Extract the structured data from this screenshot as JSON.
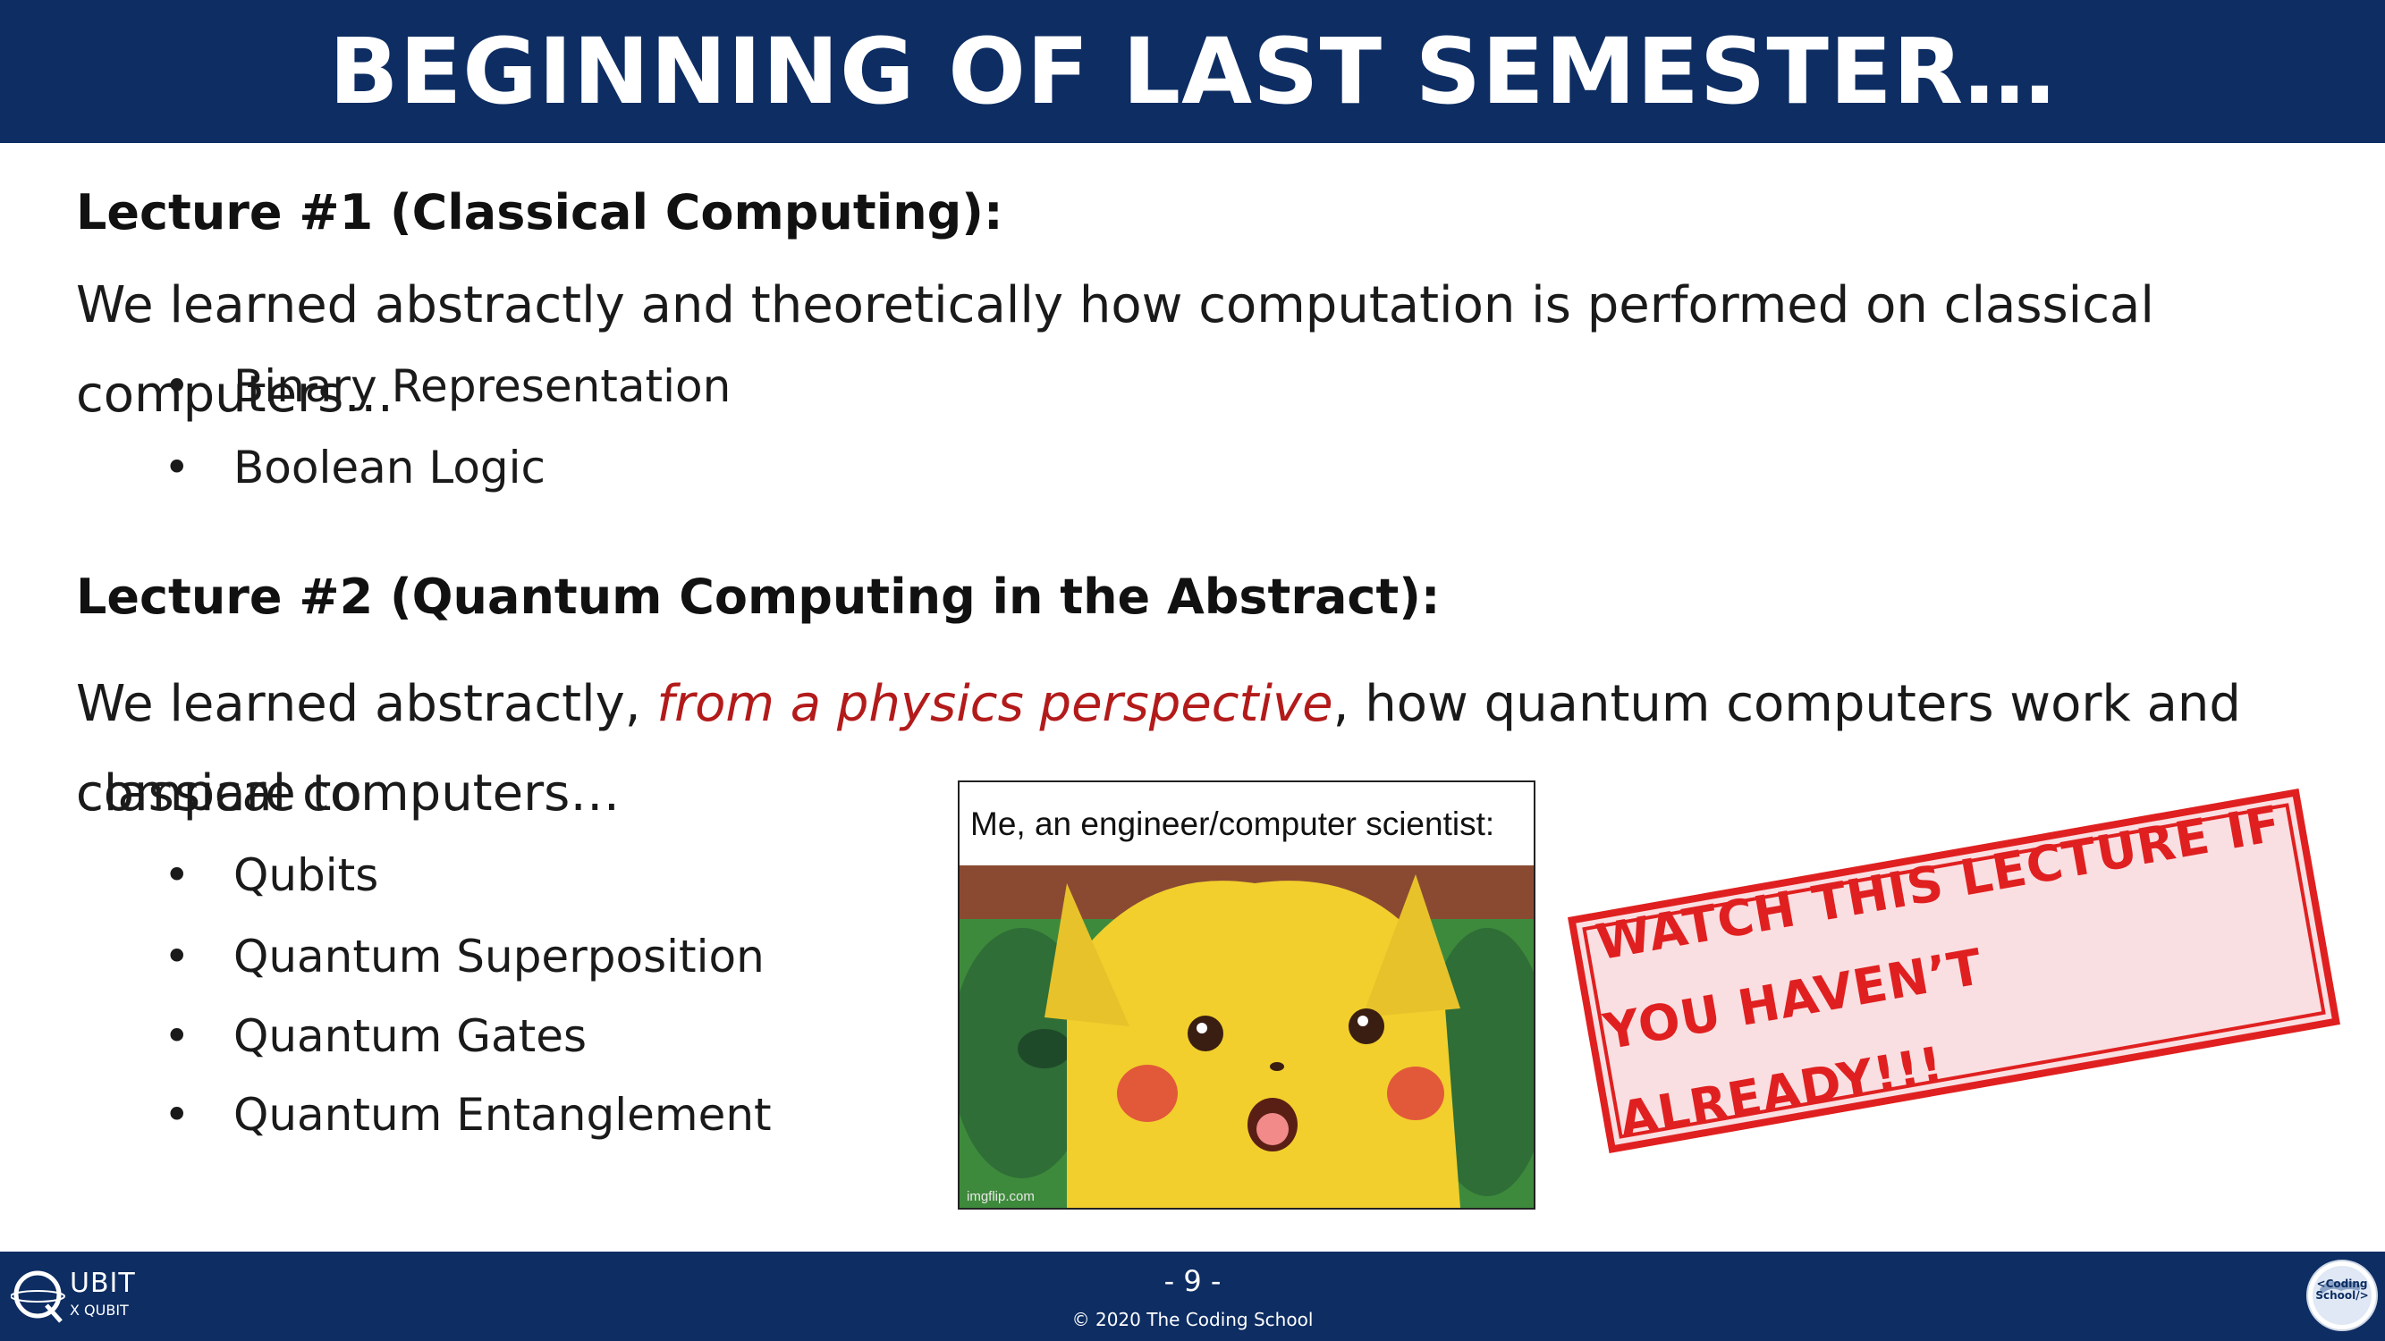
{
  "header": {
    "title": "BEGINNING OF LAST SEMESTER…"
  },
  "lecture1": {
    "title": "Lecture #1 (Classical Computing):",
    "description": "We learned abstractly and theoretically how computation is performed on classical computers…",
    "bullets": [
      "Binary Representation",
      "Boolean Logic"
    ]
  },
  "lecture2": {
    "title": "Lecture #2 (Quantum Computing in the Abstract):",
    "description_before": "We learned abstractly, ",
    "description_highlight": "from a physics perspective",
    "description_after": ", how quantum computers work and compare to",
    "description_line2": "classical computers…",
    "bullets": [
      "Qubits",
      "Quantum Superposition",
      "Quantum Gates",
      "Quantum Entanglement"
    ]
  },
  "bullet_symbol": "•",
  "meme": {
    "caption": "Me, an engineer/computer scientist:",
    "watermark": "imgflip.com"
  },
  "stamp": {
    "line1": "WATCH THIS LECTURE IF",
    "line2": "YOU HAVEN’T ALREADY!!!"
  },
  "footer": {
    "page_number": "- 9 -",
    "copyright": "© 2020 The Coding School",
    "left_logo_text": "UBIT",
    "left_logo_subtext": "X QUBIT",
    "right_logo_text_line1": "<Coding",
    "right_logo_text_line2": "School/>"
  },
  "colors": {
    "header_bg": "#0d2d63",
    "highlight": "#b31b1b",
    "stamp_red": "#e02020",
    "stamp_bg": "#f9dfe2"
  }
}
